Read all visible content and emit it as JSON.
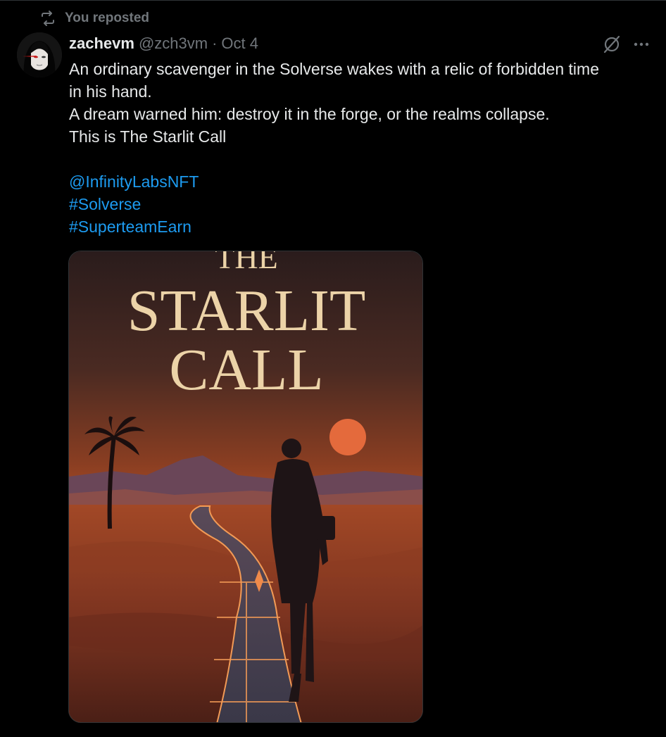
{
  "repost": {
    "label": "You reposted",
    "icon": "repost-icon"
  },
  "author": {
    "display_name": "zachevm",
    "handle": "@zch3vm",
    "separator": "·",
    "date": "Oct 4",
    "avatar_icon": "avatar"
  },
  "actions": {
    "grok_icon": "grok-icon",
    "more_icon": "more-icon"
  },
  "tweet": {
    "lines": [
      "An ordinary scavenger in the Solverse wakes with a relic of forbidden time",
      "in his hand.",
      "A dream warned him: destroy it in the forge, or the realms collapse.",
      "This is The Starlit Call"
    ],
    "mention": "@InfinityLabsNFT",
    "hashtags": [
      "#Solverse",
      "#SuperteamEarn"
    ]
  },
  "media": {
    "cover_title_line1": "THE",
    "cover_title_line2": "STARLIT",
    "cover_title_line3": "CALL"
  },
  "colors": {
    "background": "#000000",
    "text": "#e7e9ea",
    "muted": "#71767b",
    "link": "#1d9bf0",
    "cover_title": "#ecd3a8"
  }
}
